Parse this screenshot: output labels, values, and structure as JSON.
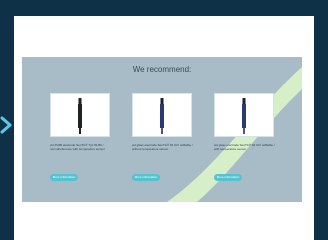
{
  "section": {
    "heading": "We recommend:"
  },
  "products": [
    {
      "description": "pH PH95 electrode SenTix® Typ 81 Blt / normalreference with temperature sensor",
      "button_label": "More information",
      "pen_color": "#1e2228"
    },
    {
      "description": "pH glass electrode SenTix® 81 KCl refillable / without temperature sensor",
      "button_label": "More information",
      "pen_color": "#2c3a73"
    },
    {
      "description": "pH glass electrode SenTix® 81 KCl refillable / with temperature sensor",
      "button_label": "More information",
      "pen_color": "#2c3a73"
    }
  ],
  "colors": {
    "background": "#0f3147",
    "panel": "#a8bcc8",
    "accent_button": "#56c2cf",
    "swoosh": "#d7efc8",
    "arrow": "#5cc8e8"
  }
}
